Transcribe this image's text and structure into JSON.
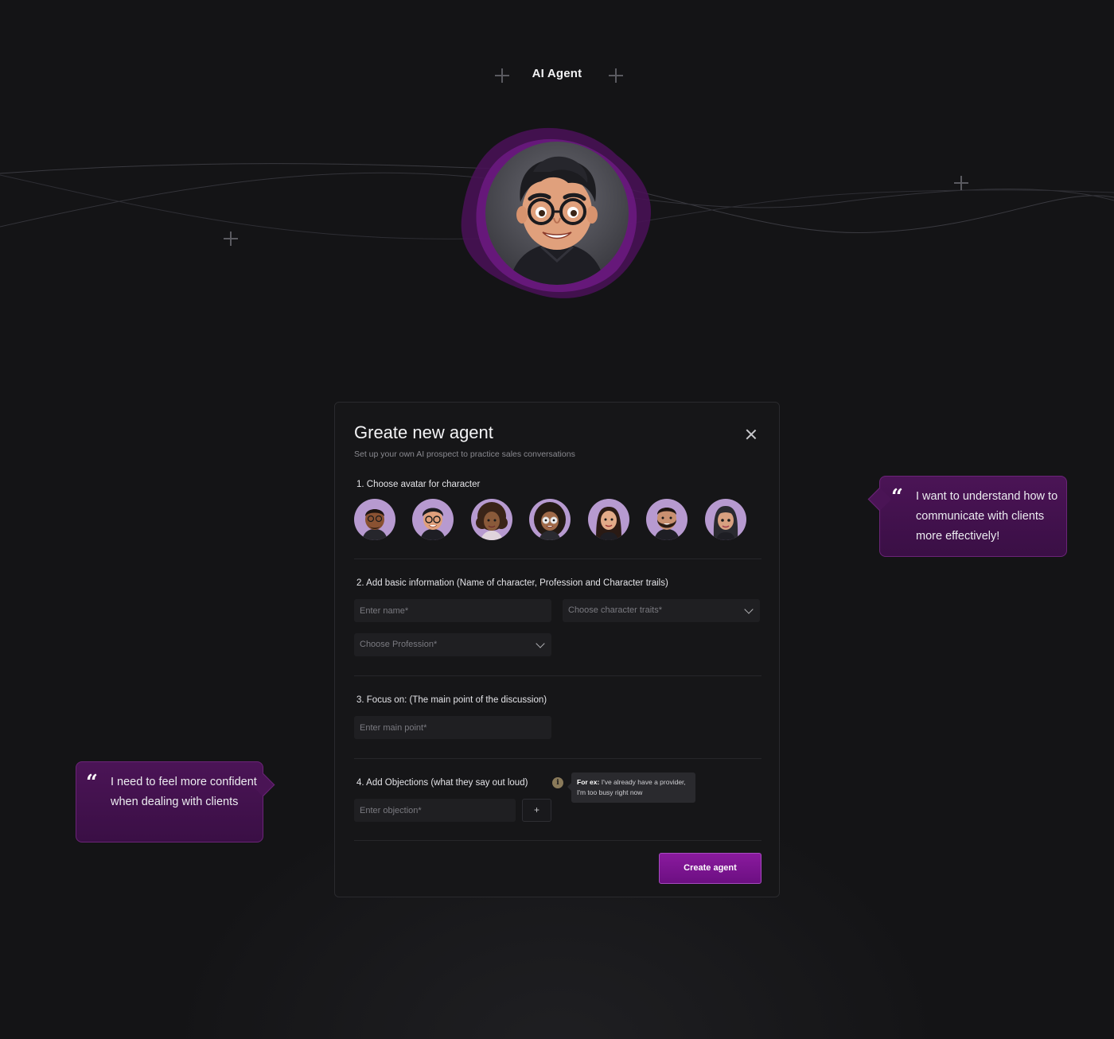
{
  "brand": {
    "title": "AI Agent"
  },
  "modal": {
    "title": "Greate new agent",
    "subtitle": "Set up your own AI prospect to practice sales conversations",
    "sections": {
      "avatar": "1. Choose avatar for character",
      "basic_info": "2. Add basic information (Name of character, Profession and Character trails)",
      "focus": "3. Focus on: (The main point of the discussion)",
      "objections": "4. Add Objections (what they say out loud)"
    },
    "fields": {
      "name_placeholder": "Enter name*",
      "traits_placeholder": "Choose character traits*",
      "profession_placeholder": "Choose Profession*",
      "main_point_placeholder": "Enter main point*",
      "objection_placeholder": "Enter objection*"
    },
    "add_button": "+",
    "info_icon": "i",
    "tooltip": {
      "prefix": "For ex:",
      "text": "I've already have a provider, I'm too busy right now"
    },
    "create_button": "Create agent",
    "avatar_count": 7
  },
  "quotes": {
    "right": "I want to understand how to communicate with clients more effectively!",
    "left": "I need to feel more confident when dealing with clients"
  },
  "colors": {
    "background": "#141416",
    "accent": "#7d1590",
    "quote_bg": "#431250",
    "avatar_bg": "#b79ad0"
  }
}
